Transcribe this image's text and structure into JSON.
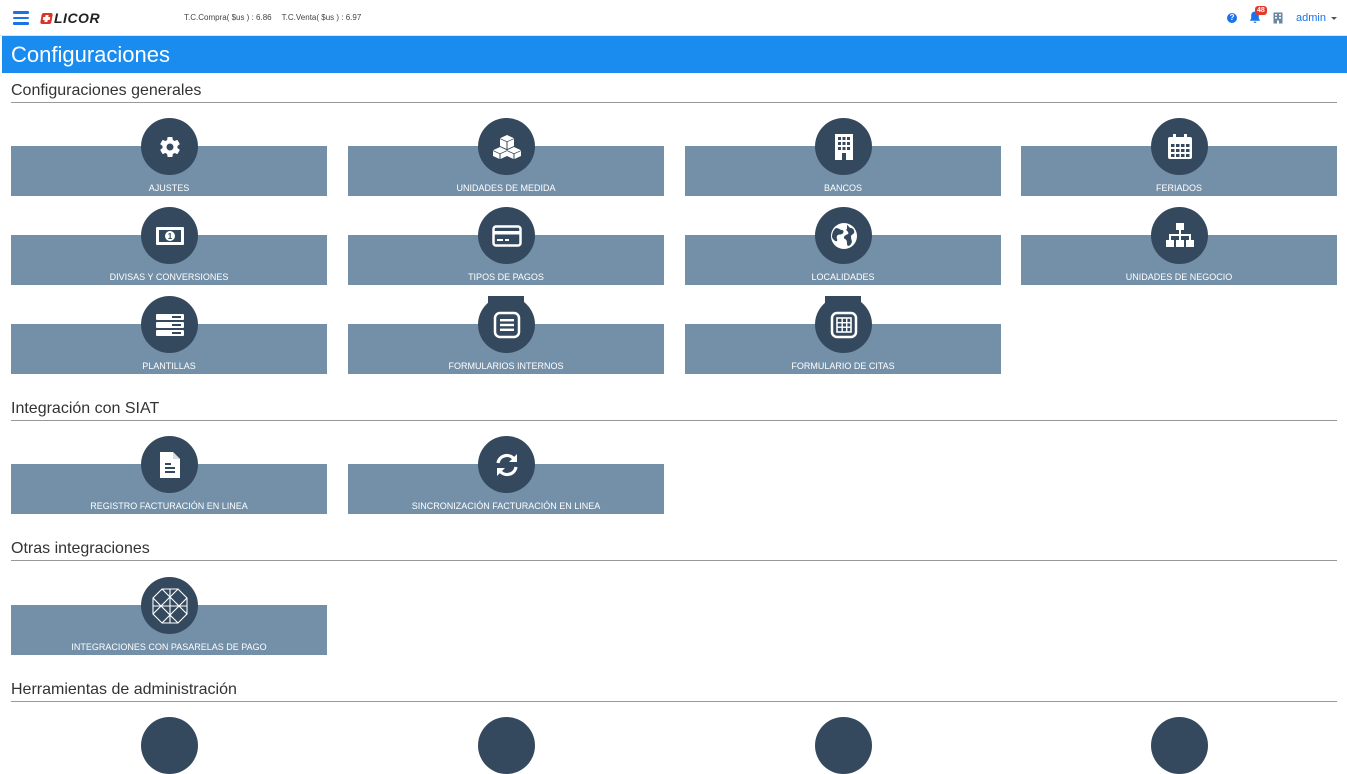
{
  "header": {
    "logo": "LICOR",
    "tc_compra": "T.C.Compra( $us ) : 6.86",
    "tc_venta": "T.C.Venta( $us ) : 6.97",
    "notif_count": "48",
    "user": "admin",
    "icons": [
      "menu-icon",
      "help-icon",
      "bell-icon",
      "building-icon"
    ]
  },
  "page": {
    "title": "Configuraciones"
  },
  "sections": {
    "generales": {
      "title": "Configuraciones generales",
      "items": [
        {
          "label": "AJUSTES",
          "icon": "gear-icon"
        },
        {
          "label": "UNIDADES DE MEDIDA",
          "icon": "cubes-icon"
        },
        {
          "label": "BANCOS",
          "icon": "building-icon"
        },
        {
          "label": "FERIADOS",
          "icon": "calendar-icon"
        },
        {
          "label": "DIVISAS Y CONVERSIONES",
          "icon": "money-icon"
        },
        {
          "label": "TIPOS DE PAGOS",
          "icon": "credit-card-icon"
        },
        {
          "label": "LOCALIDADES",
          "icon": "globe-icon"
        },
        {
          "label": "UNIDADES DE NEGOCIO",
          "icon": "sitemap-icon"
        },
        {
          "label": "PLANTILLAS",
          "icon": "server-icon"
        },
        {
          "label": "FORMULARIOS INTERNOS",
          "icon": "list-box-icon"
        },
        {
          "label": "FORMULARIO DE CITAS",
          "icon": "table-box-icon"
        }
      ]
    },
    "siat": {
      "title": "Integración con SIAT",
      "items": [
        {
          "label": "REGISTRO FACTURACIÓN EN LINEA",
          "icon": "document-icon"
        },
        {
          "label": "SINCRONIZACIÓN FACTURACIÓN EN LINEA",
          "icon": "sync-icon"
        }
      ]
    },
    "otras": {
      "title": "Otras integraciones",
      "items": [
        {
          "label": "INTEGRACIONES CON PASARELAS DE PAGO",
          "icon": "network-icon"
        }
      ]
    },
    "admin": {
      "title": "Herramientas de administración"
    }
  }
}
